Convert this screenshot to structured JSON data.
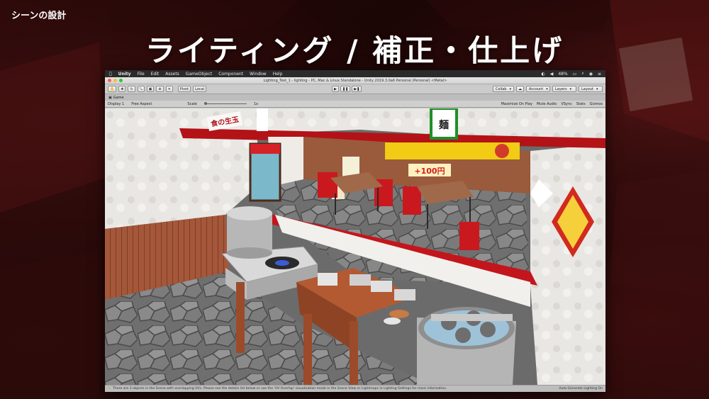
{
  "slide": {
    "section": "シーンの設計",
    "title": "ライティング / 補正・仕上げ"
  },
  "mac_menubar": {
    "app_name": "Unity",
    "items": [
      "File",
      "Edit",
      "Assets",
      "GameObject",
      "Component",
      "Window",
      "Help"
    ],
    "battery": "48%"
  },
  "window": {
    "title": "Lighting_Test_1 - lighting - PC, Mac & Linux Standalone - Unity 2019.3.0a6 Personal (Personal) <Metal>"
  },
  "toolbar": {
    "pivot_label": "Pivot",
    "local_label": "Local",
    "collab_label": "Collab",
    "account_label": "Account",
    "layers_label": "Layers",
    "layout_label": "Layout"
  },
  "game_view": {
    "tab_label": "Game",
    "display": "Display 1",
    "aspect": "Free Aspect",
    "scale_label": "Scale",
    "scale_value": "1x",
    "options": [
      "Maximize On Play",
      "Mute Audio",
      "VSync",
      "Stats",
      "Gizmos"
    ]
  },
  "scene_signs": {
    "price": "+100円"
  },
  "status": {
    "message": "There are 3 objects in the Scene with overlapping UVs. Please see the details list below or use the 'UV Overlap' visualisation mode in the Scene View or Lightmaps in Lighting Settings for more information.",
    "right": "Auto Generate Lighting On"
  }
}
